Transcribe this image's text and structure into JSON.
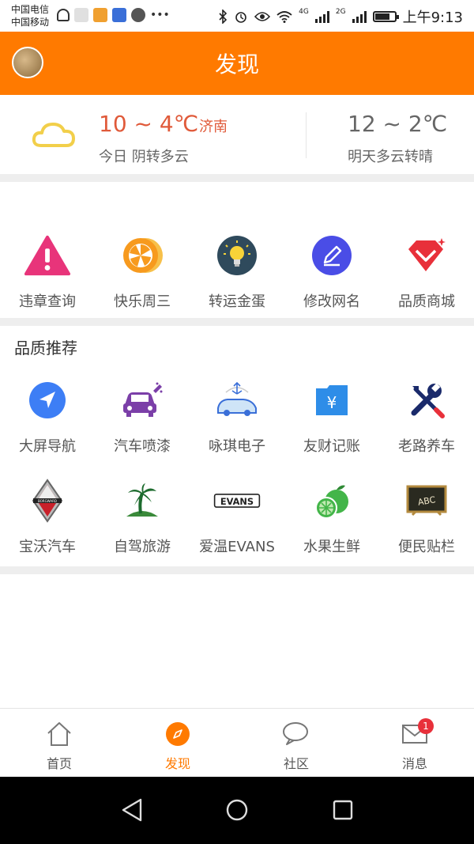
{
  "status_bar": {
    "carrier_1": "中国电信",
    "carrier_2": "中国移动",
    "net_4g": "4G",
    "net_2g": "2G",
    "time": "上午9:13"
  },
  "header": {
    "title": "发现"
  },
  "weather": {
    "today_temp": "10 ~ 4℃",
    "city": "济南",
    "today_desc": "今日 阴转多云",
    "tomorrow_temp": "12 ~ 2℃",
    "tomorrow_desc": "明天多云转晴"
  },
  "features": [
    {
      "label": "违章查询",
      "icon": "warning-icon"
    },
    {
      "label": "快乐周三",
      "icon": "orange-slice-icon"
    },
    {
      "label": "转运金蛋",
      "icon": "lightbulb-icon"
    },
    {
      "label": "修改网名",
      "icon": "edit-pencil-icon"
    },
    {
      "label": "品质商城",
      "icon": "diamond-heart-icon"
    }
  ],
  "recommend": {
    "title": "品质推荐",
    "row1": [
      {
        "label": "大屏导航",
        "icon": "navigation-arrow-icon"
      },
      {
        "label": "汽车喷漆",
        "icon": "car-paint-icon"
      },
      {
        "label": "咏琪电子",
        "icon": "car-electronics-icon"
      },
      {
        "label": "友财记账",
        "icon": "yen-wallet-icon"
      },
      {
        "label": "老路养车",
        "icon": "wrench-tools-icon"
      }
    ],
    "row2": [
      {
        "label": "宝沃汽车",
        "icon": "borgward-logo-icon"
      },
      {
        "label": "自驾旅游",
        "icon": "palm-tree-icon"
      },
      {
        "label": "爱温EVANS",
        "icon": "evans-logo-icon",
        "logo_text": "EVANS"
      },
      {
        "label": "水果生鲜",
        "icon": "citrus-fruit-icon"
      },
      {
        "label": "便民贴栏",
        "icon": "chalkboard-icon",
        "board_text": "ABC"
      }
    ]
  },
  "tabbar": {
    "tabs": [
      {
        "label": "首页",
        "icon": "home-icon"
      },
      {
        "label": "发现",
        "icon": "compass-icon",
        "active": true
      },
      {
        "label": "社区",
        "icon": "chat-bubbles-icon"
      },
      {
        "label": "消息",
        "icon": "mail-icon",
        "badge": "1"
      }
    ]
  },
  "colors": {
    "brand_orange": "#ff7a00",
    "temp_red": "#e05a3a",
    "badge_red": "#e8303a"
  }
}
